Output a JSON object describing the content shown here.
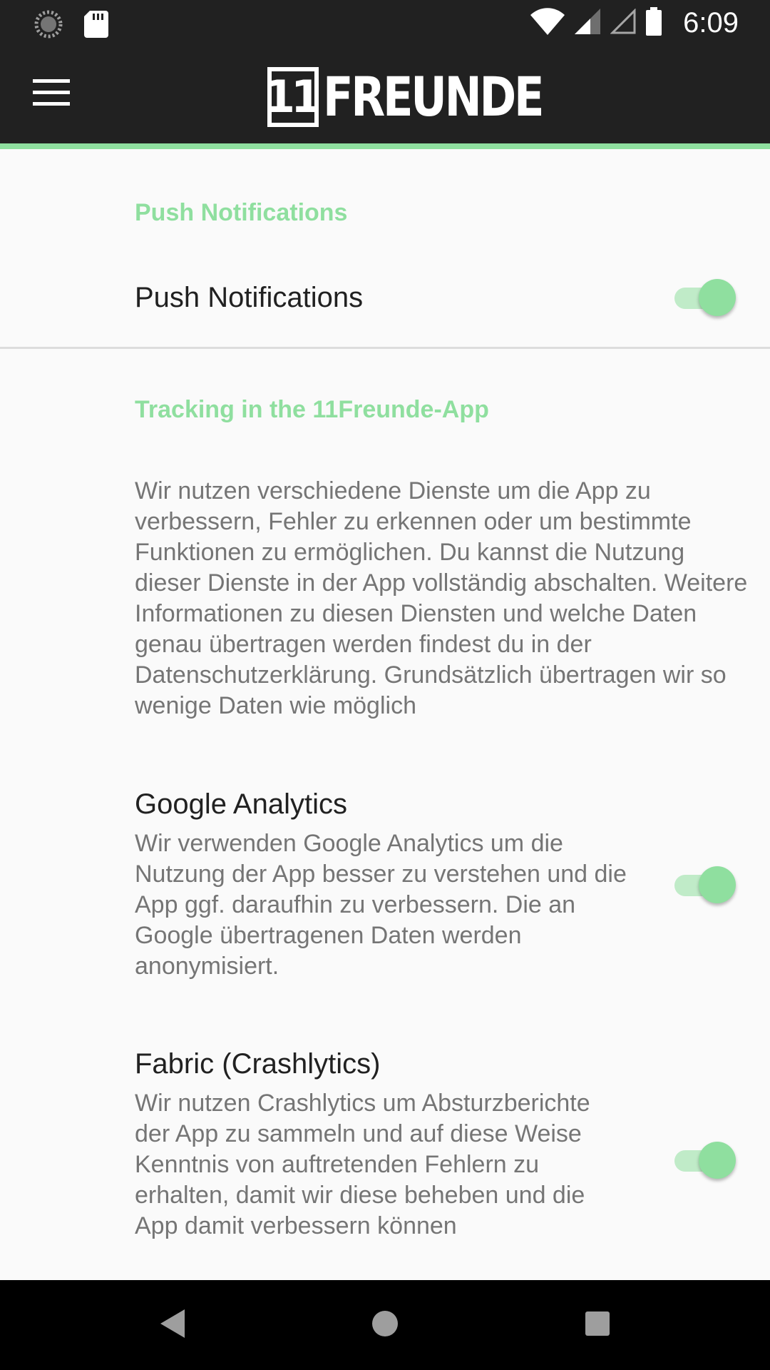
{
  "status_bar": {
    "time": "6:09",
    "icons": [
      "loading-icon",
      "sd-card-icon",
      "wifi-icon",
      "signal-icon",
      "signal-empty-icon",
      "battery-icon"
    ]
  },
  "toolbar": {
    "menu_icon": "hamburger-menu-icon",
    "logo_number": "11",
    "logo_text": "FREUNDE"
  },
  "colors": {
    "accent": "#8fdf9f",
    "toolbar_bg": "#212121",
    "background": "#fafafa",
    "primary_text": "#212121",
    "secondary_text": "#757575"
  },
  "sections": {
    "push": {
      "header": "Push Notifications",
      "setting_title": "Push Notifications",
      "enabled": true
    },
    "tracking": {
      "header": "Tracking in the 11Freunde-App",
      "intro": "Wir nutzen verschiedene Dienste um die App zu verbessern, Fehler zu erkennen oder um bestimmte Funktionen zu ermöglichen. Du kannst die Nutzung dieser Dienste in der App vollständig abschalten. Weitere Informationen zu diesen Diensten und welche Daten genau übertragen werden findest du in der Datenschutzerklärung. Grundsätzlich übertragen wir so wenige Daten wie möglich",
      "google_analytics": {
        "title": "Google Analytics",
        "description": "Wir verwenden Google Analytics um die Nutzung der App besser zu verstehen und die App ggf. daraufhin zu verbessern. Die an Google übertragenen Daten werden anonymisiert.",
        "enabled": true
      },
      "fabric": {
        "title": "Fabric (Crashlytics)",
        "description": "Wir nutzen Crashlytics um Absturzberichte der App zu sammeln und auf diese Weise Kenntnis von auftretenden Fehlern zu erhalten, damit wir diese beheben und die App damit verbessern können",
        "enabled": true
      }
    }
  },
  "nav_bar": {
    "buttons": [
      "back-icon",
      "home-icon",
      "recents-icon"
    ]
  }
}
